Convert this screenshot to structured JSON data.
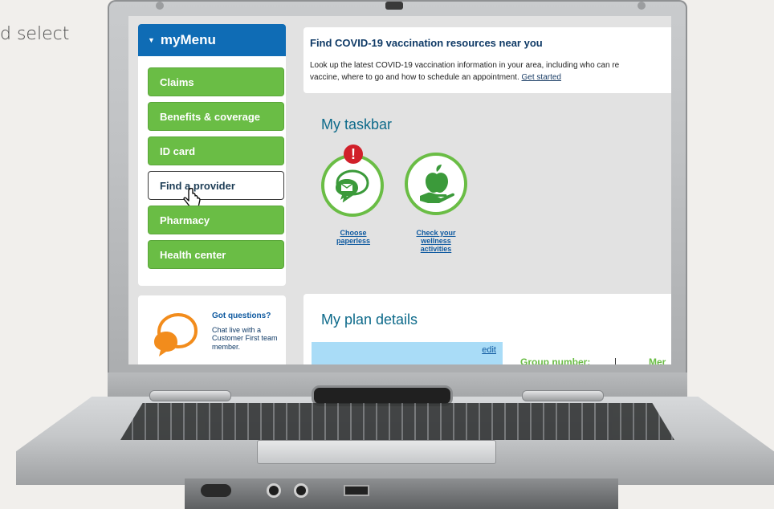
{
  "caption": {
    "text": "d select"
  },
  "menu": {
    "title": "myMenu",
    "items": [
      {
        "label": "Claims",
        "active": false
      },
      {
        "label": "Benefits & coverage",
        "active": false
      },
      {
        "label": "ID card",
        "active": false
      },
      {
        "label": "Find a provider",
        "active": true
      },
      {
        "label": "Pharmacy",
        "active": false
      },
      {
        "label": "Health center",
        "active": false
      }
    ]
  },
  "chat": {
    "title": "Got questions?",
    "text": "Chat live with a Customer First team member."
  },
  "covid": {
    "title": "Find COVID-19 vaccination resources near you",
    "line1": "Look up the latest COVID-19 vaccination information in your area, including who can re",
    "line2": "vaccine, where to go and how to schedule an appointment.",
    "link": "Get started"
  },
  "taskbar": {
    "heading": "My taskbar",
    "badge": "!",
    "items": [
      {
        "label_line1": "Choose",
        "label_line2": "paperless"
      },
      {
        "label_line1": "Check your",
        "label_line2": "wellness",
        "label_line3": "activities"
      }
    ]
  },
  "plan": {
    "heading": "My plan details",
    "edit": "edit",
    "group_label": "Group number:",
    "member_label": "Mer"
  },
  "colors": {
    "menu_header": "#0f6cb5",
    "menu_item": "#6abd45",
    "badge": "#d1202a",
    "heading_teal": "#0d6a8a",
    "plan_blue": "#a9dcf7",
    "chat_orange": "#f28c1c"
  }
}
